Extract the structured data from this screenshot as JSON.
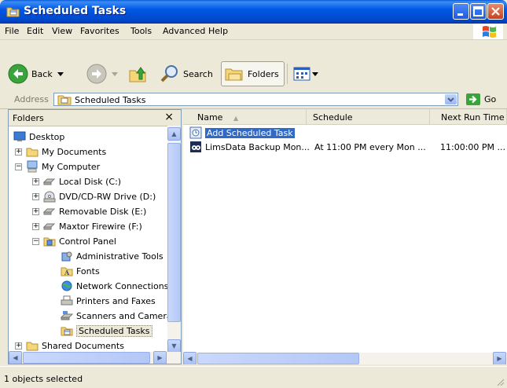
{
  "window": {
    "title": "Scheduled Tasks",
    "accent": "#0058E6"
  },
  "menu": [
    {
      "label": "File",
      "underline": "F",
      "rest": "ile"
    },
    {
      "label": "Edit",
      "underline": "E",
      "rest": "dit"
    },
    {
      "label": "View",
      "underline": "V",
      "rest": "iew"
    },
    {
      "label": "Favorites",
      "underline": "a",
      "pre": "F",
      "rest": "vorites"
    },
    {
      "label": "Tools",
      "underline": "T",
      "rest": "ools"
    },
    {
      "label": "Advanced",
      "underline": "A",
      "rest": "dvanced"
    },
    {
      "label": "Help",
      "underline": "H",
      "rest": "elp"
    }
  ],
  "toolbar": {
    "back_label": "Back",
    "search_label": "Search",
    "folders_label": "Folders"
  },
  "address": {
    "label": "Address",
    "value": "Scheduled Tasks",
    "go_label": "Go"
  },
  "folders_pane": {
    "title": "Folders",
    "close_glyph": "×",
    "tree": [
      {
        "label": "Desktop",
        "level": 0,
        "expander": "",
        "icon": "desktop-icon"
      },
      {
        "label": "My Documents",
        "level": 1,
        "expander": "+",
        "icon": "folder-icon"
      },
      {
        "label": "My Computer",
        "level": 1,
        "expander": "−",
        "icon": "computer-icon"
      },
      {
        "label": "Local Disk (C:)",
        "level": 2,
        "expander": "+",
        "icon": "disk-icon"
      },
      {
        "label": "DVD/CD-RW Drive (D:)",
        "level": 2,
        "expander": "+",
        "icon": "cd-icon"
      },
      {
        "label": "Removable Disk (E:)",
        "level": 2,
        "expander": "+",
        "icon": "disk-icon"
      },
      {
        "label": "Maxtor Firewire (F:)",
        "level": 2,
        "expander": "+",
        "icon": "disk-icon"
      },
      {
        "label": "Control Panel",
        "level": 2,
        "expander": "−",
        "icon": "control-panel-icon"
      },
      {
        "label": "Administrative Tools",
        "level": 3,
        "expander": "",
        "icon": "admin-tools-icon"
      },
      {
        "label": "Fonts",
        "level": 3,
        "expander": "",
        "icon": "fonts-icon"
      },
      {
        "label": "Network Connections",
        "level": 3,
        "expander": "",
        "icon": "network-icon"
      },
      {
        "label": "Printers and Faxes",
        "level": 3,
        "expander": "",
        "icon": "printer-icon"
      },
      {
        "label": "Scanners and Cameras",
        "level": 3,
        "expander": "",
        "icon": "scanner-icon"
      },
      {
        "label": "Scheduled Tasks",
        "level": 3,
        "expander": "",
        "icon": "scheduled-tasks-icon",
        "selected": true
      },
      {
        "label": "Shared Documents",
        "level": 1,
        "expander": "+",
        "icon": "folder-icon"
      }
    ]
  },
  "list": {
    "columns": [
      "Name",
      "Schedule",
      "Next Run Time"
    ],
    "sort_glyph": "▲",
    "rows": [
      {
        "name": "Add Scheduled Task",
        "schedule": "",
        "next_run": "",
        "icon": "add-task-icon",
        "selected": true
      },
      {
        "name": "LimsData Backup Mon...",
        "schedule": "At 11:00 PM every Mon ...",
        "next_run": "11:00:00 PM ...",
        "icon": "task-icon"
      }
    ]
  },
  "status": {
    "text": "1 objects selected"
  }
}
